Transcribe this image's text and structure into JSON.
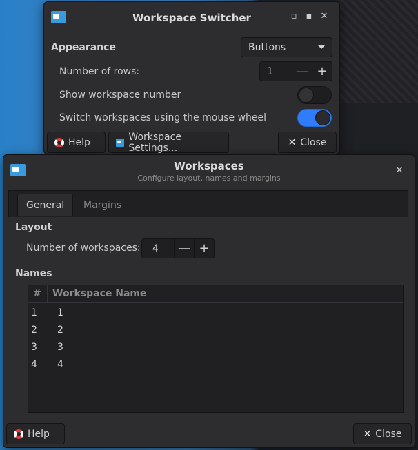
{
  "switcher": {
    "title": "Workspace Switcher",
    "minimize_glyph": "▫",
    "maximize_glyph": "▪",
    "close_glyph": "✕",
    "appearance_label": "Appearance",
    "appearance_value": "Buttons",
    "rows_label": "Number of rows:",
    "rows_value": "1",
    "show_number_label": "Show workspace number",
    "show_number_on": false,
    "mouse_wheel_label": "Switch workspaces using the mouse wheel",
    "mouse_wheel_on": true,
    "help_label": "Help",
    "settings_label": "Workspace Settings...",
    "close_label": "Close"
  },
  "workspaces": {
    "title": "Workspaces",
    "subtitle": "Configure layout, names and margins",
    "close_glyph": "✕",
    "tabs": [
      "General",
      "Margins"
    ],
    "layout_heading": "Layout",
    "count_label": "Number of workspaces:",
    "count_value": "4",
    "names_heading": "Names",
    "columns": [
      "#",
      "Workspace Name"
    ],
    "rows": [
      {
        "num": "1",
        "name": "1"
      },
      {
        "num": "2",
        "name": "2"
      },
      {
        "num": "3",
        "name": "3"
      },
      {
        "num": "4",
        "name": "4"
      }
    ],
    "help_label": "Help",
    "close_label": "Close"
  },
  "glyphs": {
    "minus": "—",
    "plus": "+",
    "close": "✕"
  },
  "colors": {
    "accent": "#2f7dfc",
    "window_bg": "#2d2d30",
    "app_icon": "#3a9ae0"
  }
}
